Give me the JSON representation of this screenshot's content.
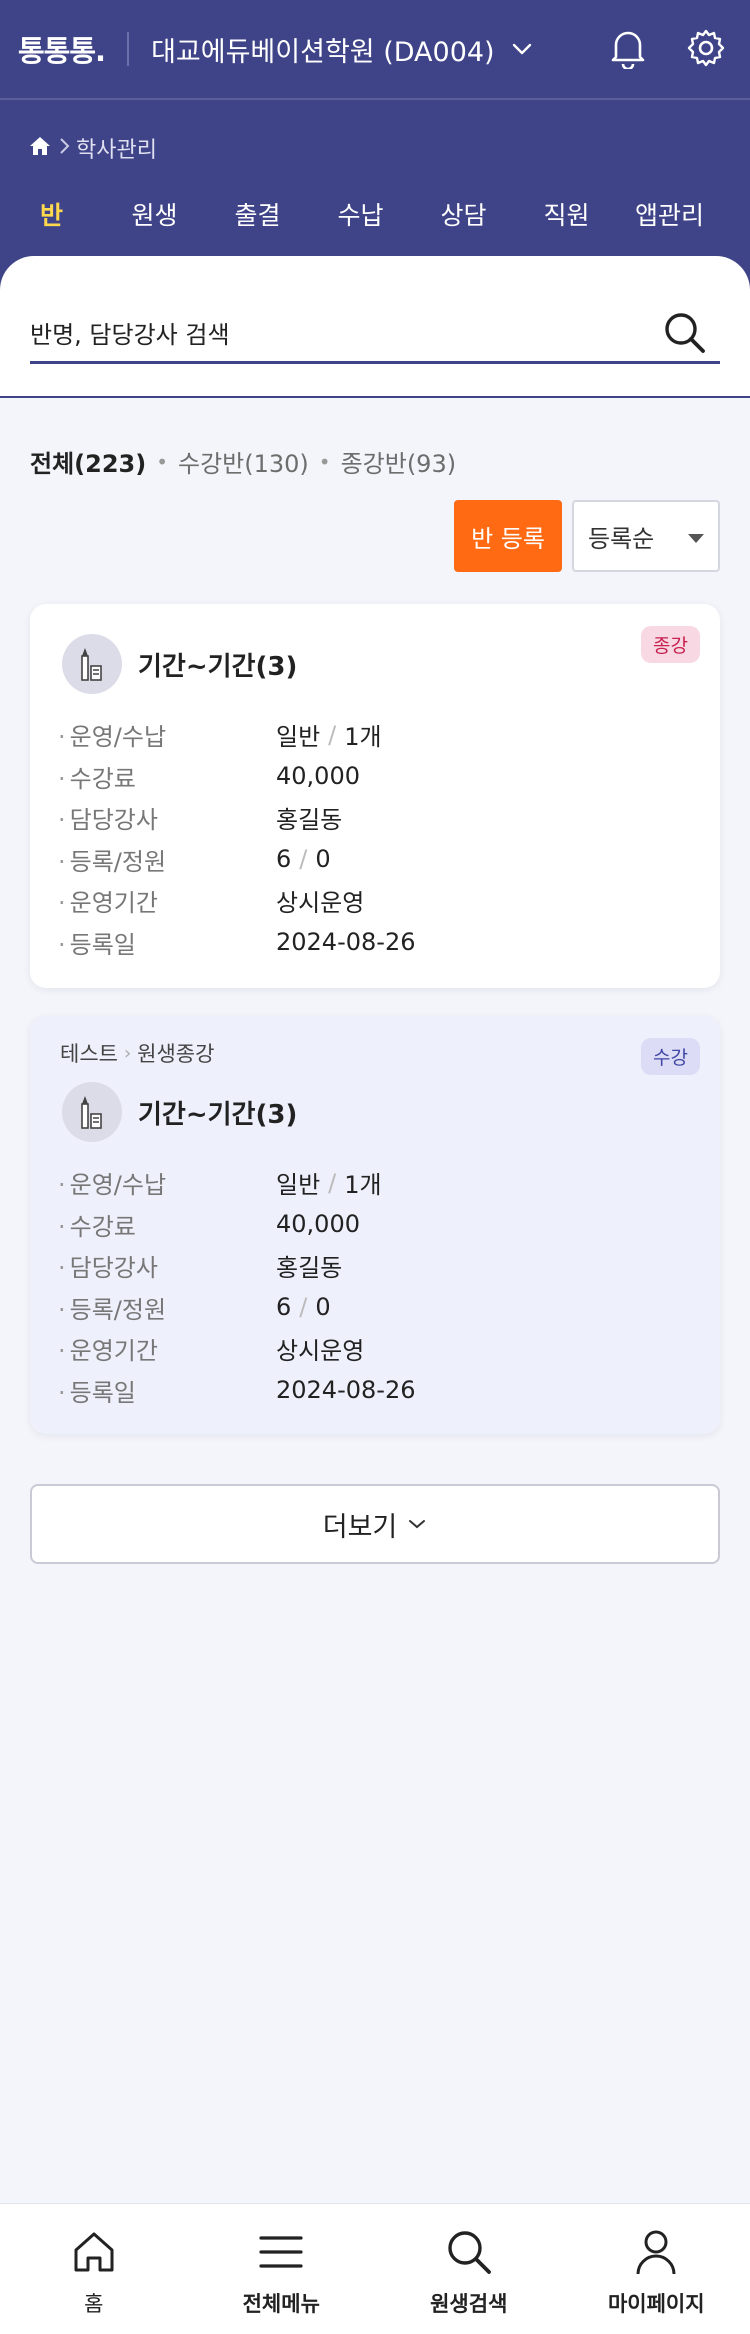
{
  "header": {
    "logo": "통통통.",
    "academy_name": "대교에듀베이션학원 (DA004)",
    "breadcrumb": "학사관리"
  },
  "tabs": [
    {
      "label": "반",
      "active": true
    },
    {
      "label": "원생",
      "active": false
    },
    {
      "label": "출결",
      "active": false
    },
    {
      "label": "수납",
      "active": false
    },
    {
      "label": "상담",
      "active": false
    },
    {
      "label": "직원",
      "active": false
    },
    {
      "label": "앱관리",
      "active": false
    }
  ],
  "search": {
    "placeholder": "반명, 담당강사 검색"
  },
  "summary": {
    "all": "전체(223)",
    "taking": "수강반(130)",
    "ended": "종강반(93)"
  },
  "actions": {
    "register": "반 등록",
    "sort": "등록순"
  },
  "cards": [
    {
      "path": null,
      "badge": "종강",
      "title": "기간~기간(3)",
      "rows": [
        {
          "k": "운영/수납",
          "v1": "일반",
          "v2": "1개"
        },
        {
          "k": "수강료",
          "v": "40,000"
        },
        {
          "k": "담당강사",
          "v": "홍길동"
        },
        {
          "k": "등록/정원",
          "v1": "6",
          "v2": "0"
        },
        {
          "k": "운영기간",
          "v": "상시운영"
        },
        {
          "k": "등록일",
          "v": "2024-08-26"
        }
      ]
    },
    {
      "path": [
        "테스트",
        "원생종강"
      ],
      "badge": "수강",
      "title": "기간~기간(3)",
      "rows": [
        {
          "k": "운영/수납",
          "v1": "일반",
          "v2": "1개"
        },
        {
          "k": "수강료",
          "v": "40,000"
        },
        {
          "k": "담당강사",
          "v": "홍길동"
        },
        {
          "k": "등록/정원",
          "v1": "6",
          "v2": "0"
        },
        {
          "k": "운영기간",
          "v": "상시운영"
        },
        {
          "k": "등록일",
          "v": "2024-08-26"
        }
      ]
    }
  ],
  "more_label": "더보기",
  "bottom_nav": [
    {
      "label": "홈",
      "icon": "home-icon"
    },
    {
      "label": "전체메뉴",
      "icon": "menu-icon"
    },
    {
      "label": "원생검색",
      "icon": "search-icon"
    },
    {
      "label": "마이페이지",
      "icon": "user-icon"
    }
  ],
  "colors": {
    "header": "#3f4488",
    "active_tab": "#ffd84d",
    "primary_button": "#ff6a13",
    "badge_end": "#c8204f",
    "badge_taking": "#4046a4"
  }
}
